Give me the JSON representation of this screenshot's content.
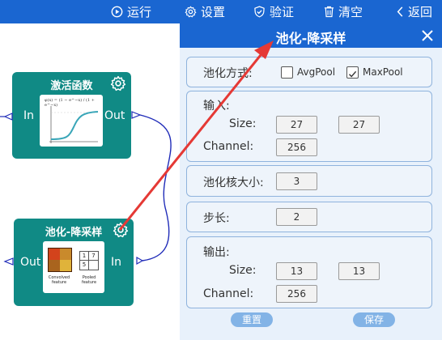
{
  "toolbar": {
    "run_label": "运行",
    "settings_label": "设置",
    "verify_label": "验证",
    "clear_label": "清空",
    "back_label": "返回"
  },
  "nodes": {
    "activation": {
      "title": "激活函数",
      "in_label": "In",
      "out_label": "Out",
      "formula": "φ(x) = (1 − e^−x) / (1 + e^−x)"
    },
    "pooling": {
      "title": "池化-降采样",
      "in_label": "In",
      "out_label": "Out",
      "caption_left": "Convolved feature",
      "caption_right": "Pooled feature",
      "pooled_values": [
        "1",
        "7",
        "5",
        ""
      ]
    }
  },
  "panel": {
    "title": "池化-降采样",
    "pool_method": {
      "label": "池化方式:",
      "options": [
        {
          "label": "AvgPool",
          "checked": false
        },
        {
          "label": "MaxPool",
          "checked": true
        }
      ]
    },
    "input": {
      "label": "输入:",
      "size_label": "Size:",
      "size": [
        "27",
        "27"
      ],
      "channel_label": "Channel:",
      "channel": "256"
    },
    "kernel": {
      "label": "池化核大小:",
      "value": "3"
    },
    "stride": {
      "label": "步长:",
      "value": "2"
    },
    "output": {
      "label": "输出:",
      "size_label": "Size:",
      "size": [
        "13",
        "13"
      ],
      "channel_label": "Channel:",
      "channel": "256"
    },
    "reset_label": "重置",
    "save_label": "保存"
  },
  "colors": {
    "toolbar_blue": "#1a66d1",
    "node_teal": "#108a85",
    "connector_blue": "#1f2bb8",
    "arrow_red": "#e53935",
    "button_blue": "#82b3e6"
  }
}
